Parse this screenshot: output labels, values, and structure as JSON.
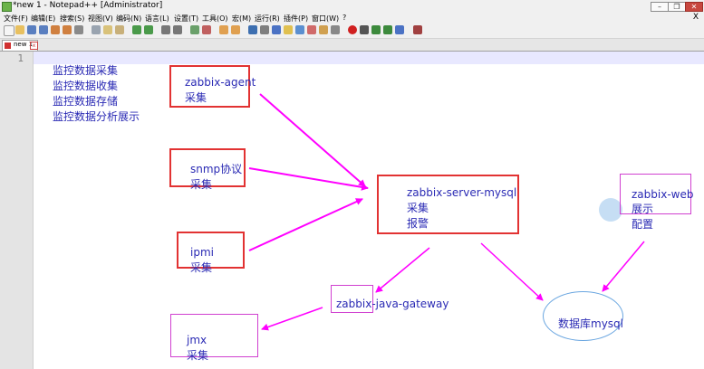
{
  "window": {
    "title": "*new 1 - Notepad++ [Administrator]",
    "minimize": "–",
    "restore": "❐",
    "close": "✕"
  },
  "menu": {
    "items": [
      "文件(F)",
      "编辑(E)",
      "搜索(S)",
      "视图(V)",
      "编码(N)",
      "语言(L)",
      "设置(T)",
      "工具(O)",
      "宏(M)",
      "运行(R)",
      "插件(P)",
      "窗口(W)",
      "?"
    ],
    "close_label": "X"
  },
  "tab": {
    "label": "new 1",
    "close": "x"
  },
  "editor": {
    "line_number": "1",
    "left_list": [
      "监控数据采集",
      "监控数据收集",
      "监控数据存储",
      "监控数据分析展示"
    ],
    "agent": {
      "name": "zabbix-agent",
      "sub": "采集"
    },
    "snmp": {
      "name": "snmp协议",
      "sub": "采集"
    },
    "ipmi": {
      "name": "ipmi",
      "sub": "采集"
    },
    "server": {
      "name": "zabbix-server-mysql",
      "sub1": "采集",
      "sub2": "报警"
    },
    "web": {
      "name": "zabbix-web",
      "sub1": "展示",
      "sub2": "配置"
    },
    "gateway": {
      "name": "zabbix-java-gateway"
    },
    "jmx": {
      "name": "jmx",
      "sub": "采集"
    },
    "db": {
      "name": "数据库mysql"
    }
  },
  "colors": {
    "text": "#2a2ab4",
    "box": "#e23232",
    "arrow": "#ff00ff",
    "ellipse": "#6aa6e0"
  }
}
